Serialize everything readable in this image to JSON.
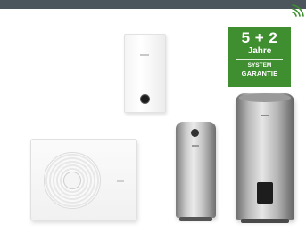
{
  "badge": {
    "years": "5 + 2",
    "unit": "Jahre",
    "line1": "SYSTEM",
    "line2": "GARANTIE",
    "color": "#3f8e30"
  },
  "icons": {
    "connectivity": "wifi-icon"
  },
  "colors": {
    "top_bar": "#4d555c",
    "background": "#ffffff"
  }
}
